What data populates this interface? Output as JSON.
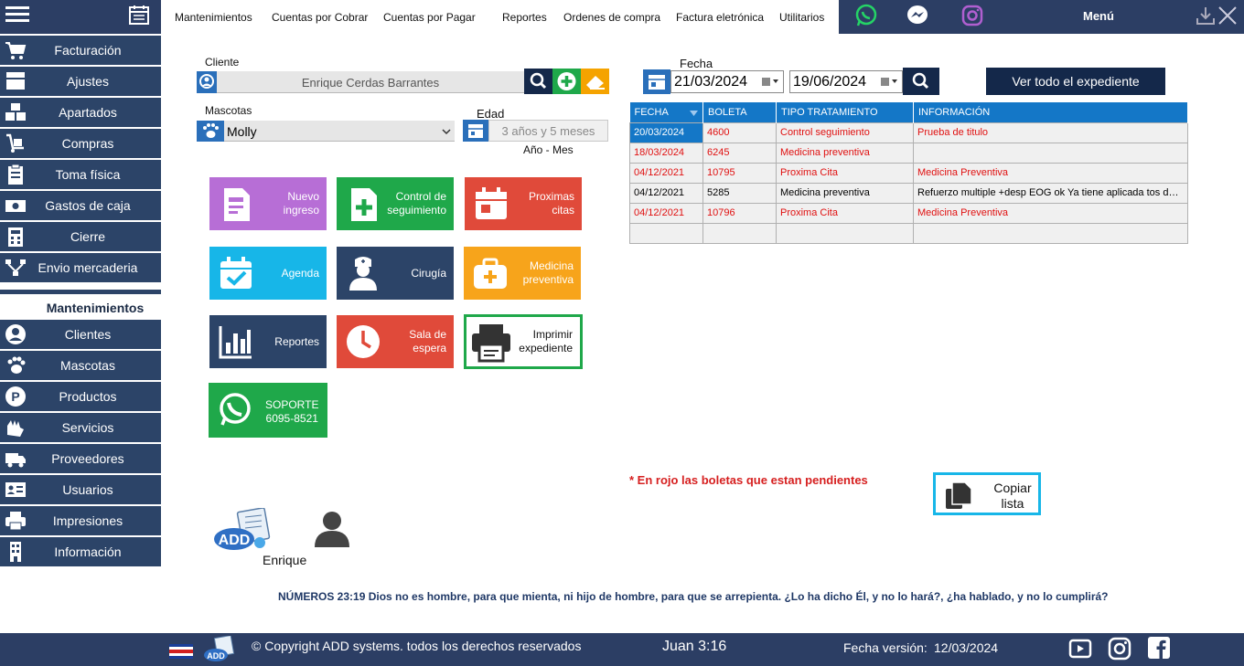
{
  "topbar": {
    "menu_items": [
      "Mantenimientos",
      "Cuentas por Cobrar",
      "Cuentas por Pagar",
      "Reportes",
      "Ordenes de compra",
      "Factura eletrónica",
      "Utilitarios"
    ],
    "menu_label": "Menú"
  },
  "sidebar": {
    "items_top": [
      "Facturación",
      "Ajustes",
      "Apartados",
      "Compras",
      "Toma física",
      "Gastos de caja",
      "Cierre",
      "Envio mercaderia"
    ],
    "section": "Mantenimientos",
    "items_bottom": [
      "Clientes",
      "Mascotas",
      "Productos",
      "Servicios",
      "Proveedores",
      "Usuarios",
      "Impresiones",
      "Información"
    ]
  },
  "cliente": {
    "label": "Cliente",
    "value": "Enrique Cerdas Barrantes"
  },
  "mascotas": {
    "label": "Mascotas",
    "value": "Molly"
  },
  "edad": {
    "label": "Edad",
    "value": "3 años y 5 meses",
    "hint": "Año - Mes"
  },
  "tiles": {
    "nuevo": "Nuevo ingreso",
    "control": "Control de seguimiento",
    "proximas": "Proximas citas",
    "agenda": "Agenda",
    "cirugia": "Cirugía",
    "medicina": "Medicina preventiva",
    "reportes": "Reportes",
    "sala": "Sala de espera",
    "imprimir": "Imprimir expediente",
    "soporte_title": "SOPORTE",
    "soporte_phone": "6095-8521"
  },
  "fecha": {
    "label": "Fecha",
    "desde": "21/03/2024",
    "hasta": "19/06/2024"
  },
  "ver_todo": "Ver todo el expediente",
  "table": {
    "headers": [
      "FECHA",
      "BOLETA",
      "TIPO TRATAMIENTO",
      "INFORMACIÓN"
    ],
    "rows": [
      [
        "20/03/2024",
        "4600",
        "Control seguimiento",
        "Prueba de titulo"
      ],
      [
        "18/03/2024",
        "6245",
        "Medicina preventiva",
        ""
      ],
      [
        "04/12/2021",
        "10795",
        "Proxima Cita",
        "Medicina Preventiva"
      ],
      [
        "04/12/2021",
        "5285",
        "Medicina preventiva",
        "Refuerzo multiple +desp EOG ok Ya tiene aplicada tos de pe..."
      ],
      [
        "04/12/2021",
        "10796",
        "Proxima Cita",
        "Medicina Preventiva"
      ],
      [
        "",
        "",
        "",
        ""
      ]
    ]
  },
  "nota_rojo": "* En rojo las boletas que estan pendientes",
  "copiar": "Copiar lista",
  "usuario": "Enrique",
  "versiculo": "NÚMEROS 23:19  Dios no es hombre, para que mienta, ni hijo de hombre, para que se arrepienta. ¿Lo ha dicho Él, y no lo hará?, ¿ha hablado, y no lo cumplirá?",
  "footer": {
    "copyright": "© Copyright ADD systems. todos los derechos reservados",
    "verse_ref": "Juan 3:16",
    "version_label": "Fecha versión:",
    "version_date": "12/03/2024"
  },
  "logo_text": "ADD"
}
